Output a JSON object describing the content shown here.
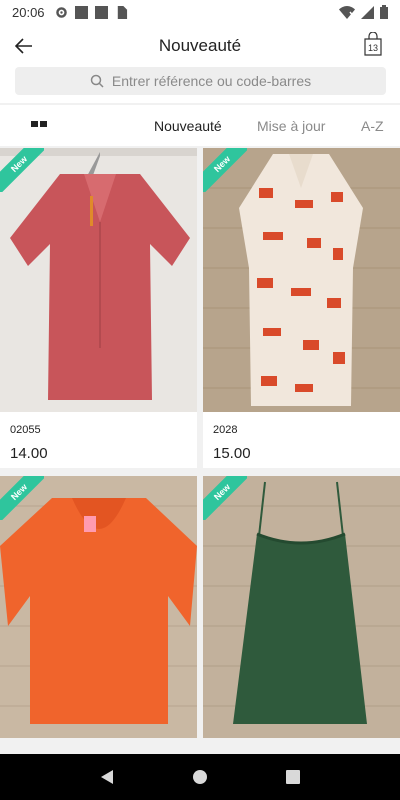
{
  "status_bar": {
    "time": "20:06",
    "icons": [
      "gear-icon",
      "notification-square-icon",
      "notification-square-icon",
      "sim-card-icon",
      "wifi-off-icon",
      "signal-icon",
      "battery-icon"
    ]
  },
  "app_bar": {
    "title": "Nouveauté",
    "back_icon": "arrow-left-icon",
    "cart_icon": "shopping-bag-icon",
    "cart_count": "13"
  },
  "search": {
    "placeholder": "Entrer référence ou code-barres",
    "icon": "search-icon"
  },
  "sort_bar": {
    "view_toggle_icon": "grid-view-icon",
    "tabs": [
      {
        "label": "Nouveauté",
        "active": true
      },
      {
        "label": "Mise à jour",
        "active": false
      },
      {
        "label": "A-Z",
        "active": false
      }
    ],
    "active_color": "#222222",
    "inactive_color": "#8a8a8a"
  },
  "products": [
    {
      "badge": "New",
      "reference": "02055",
      "price": "14.00",
      "color": "#c8555a"
    },
    {
      "badge": "New",
      "reference": "2028",
      "price": "15.00",
      "color": "#d94a2a"
    },
    {
      "badge": "New",
      "reference": "",
      "price": "",
      "color": "#f0642c"
    },
    {
      "badge": "New",
      "reference": "",
      "price": "",
      "color": "#2f5a3c"
    }
  ],
  "badge_color": "#2fc59d",
  "nav_bar": {
    "icons": [
      "back-triangle-icon",
      "home-circle-icon",
      "recents-square-icon"
    ]
  }
}
